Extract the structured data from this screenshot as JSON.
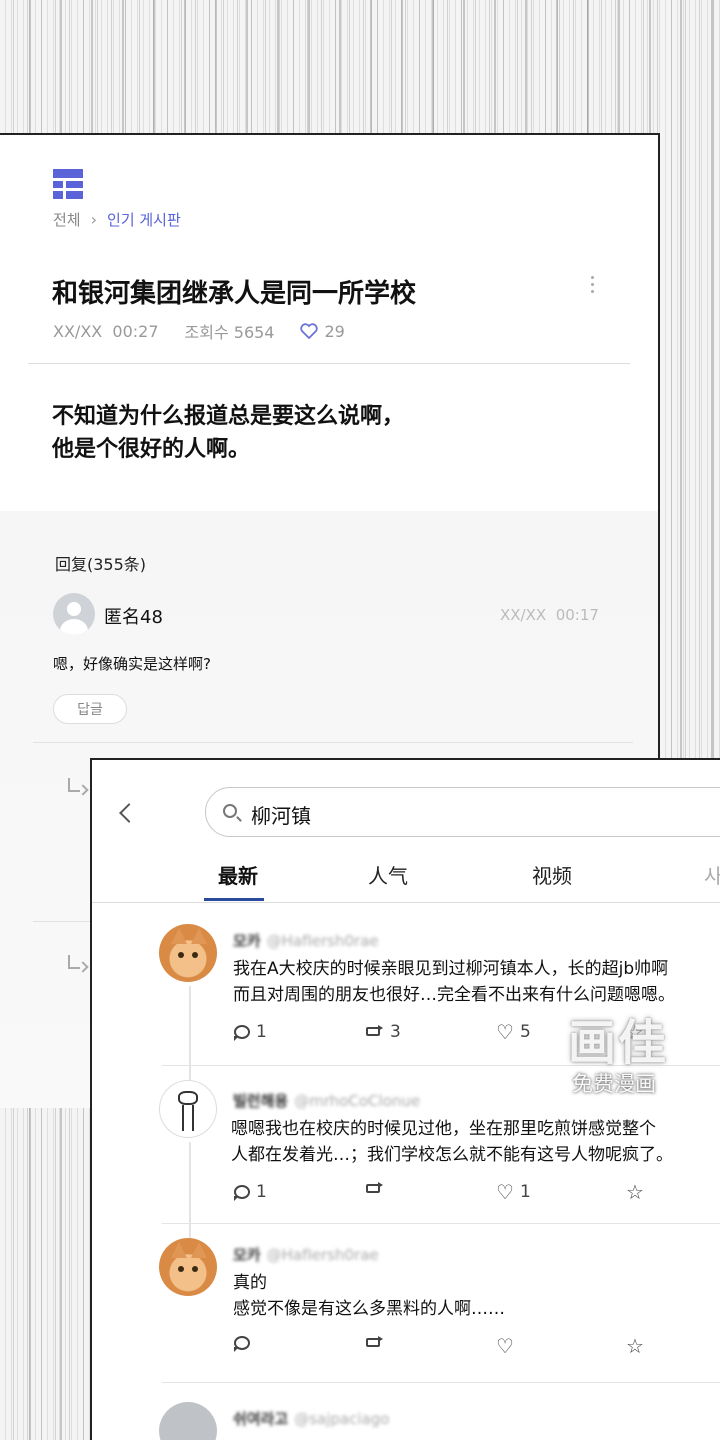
{
  "post": {
    "breadcrumb": {
      "root": "전체",
      "current": "인기 게시판"
    },
    "title": "和银河集团继承人是同一所学校",
    "date": "XX/XX",
    "time": "00:27",
    "views_label": "조회수 5654",
    "likes": "29",
    "body_lines": [
      "不知道为什么报道总是要这么说啊，",
      "他是个很好的人啊。"
    ]
  },
  "replies": {
    "count_label": "回复(355条)",
    "first": {
      "user": "匿名48",
      "date": "XX/XX",
      "time": "00:17",
      "text": "嗯，好像确实是这样啊?",
      "reply_button": "답글"
    }
  },
  "search": {
    "query": "柳河镇",
    "tabs": [
      "最新",
      "人气",
      "视频",
      "사"
    ],
    "active_tab": "最新",
    "results": [
      {
        "name": "모카",
        "handle": "@HafIersh0rae",
        "avatar": "cat-photo",
        "lines": [
          "我在A大校庆的时候亲眼见到过柳河镇本人，长的超jb帅啊",
          "而且对周围的朋友也很好…完全看不出来有什么问题嗯嗯。"
        ],
        "replies": "1",
        "retweets": "3",
        "likes": "5",
        "fav": ""
      },
      {
        "name": "빌런해용",
        "handle": "@mrhoCoClonue",
        "avatar": "drawn-alpaca",
        "lines": [
          "嗯嗯我也在校庆的时候见过他，坐在那里吃煎饼感觉整个",
          "人都在发着光…；我们学校怎么就不能有这号人物呢疯了。"
        ],
        "replies": "1",
        "retweets": "",
        "likes": "1",
        "fav": ""
      },
      {
        "name": "모카",
        "handle": "@HafIersh0rae",
        "avatar": "cat-photo",
        "lines": [
          "真的",
          "感觉不像是有这么多黑料的人啊……"
        ],
        "replies": "",
        "retweets": "",
        "likes": "",
        "fav": ""
      },
      {
        "name": "쉬여라고",
        "handle": "@sajpaciago",
        "avatar": "gray-default",
        "lines": [],
        "replies": "",
        "retweets": "",
        "likes": "",
        "fav": ""
      }
    ]
  },
  "watermark": {
    "logo": "画佳",
    "text": "免费漫画"
  },
  "colors": {
    "accent": "#5a63d8",
    "tab_underline": "#2a4b9b",
    "panel_border": "#222222"
  },
  "icons": [
    "board-logo-icon",
    "chevron-right-icon",
    "more-vert-icon",
    "heart-icon",
    "avatar-icon",
    "reply-arrow-icon",
    "back-chevron-icon",
    "search-icon",
    "comment-icon",
    "retweet-icon",
    "star-icon"
  ]
}
